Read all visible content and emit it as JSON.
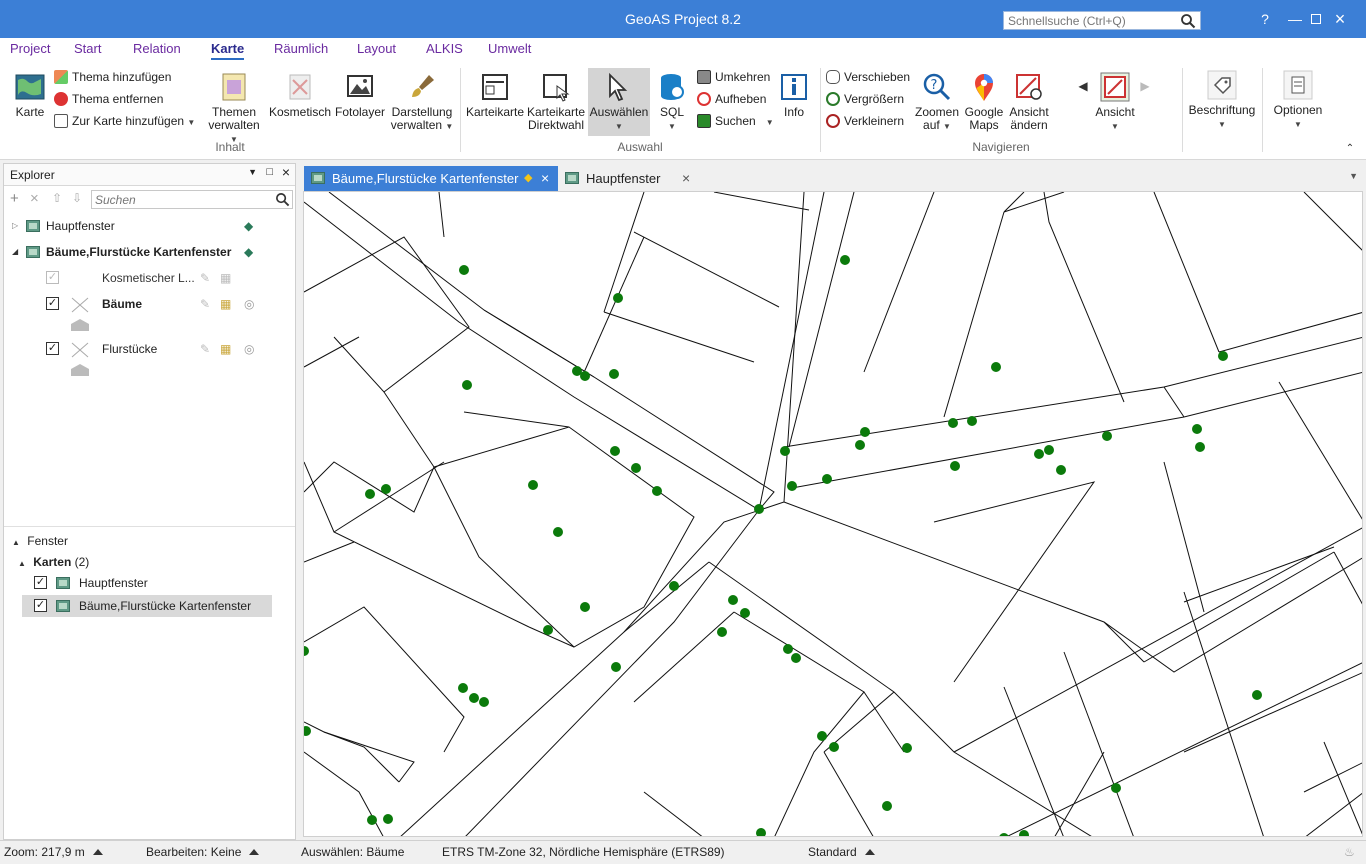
{
  "window": {
    "title": "GeoAS Project 8.2",
    "quick_search_placeholder": "Schnellsuche (Ctrl+Q)"
  },
  "ribbon_tabs": [
    "Project",
    "Start",
    "Relation",
    "Karte",
    "Räumlich",
    "Layout",
    "ALKIS",
    "Umwelt"
  ],
  "active_tab": "Karte",
  "ribbon": {
    "karte": "Karte",
    "thema_hinzufuegen": "Thema hinzufügen",
    "thema_entfernen": "Thema entfernen",
    "zur_karte_hinzufuegen": "Zur Karte hinzufügen",
    "themen_verwalten_1": "Themen",
    "themen_verwalten_2": "verwalten",
    "kosmetisch": "Kosmetisch",
    "fotolayer": "Fotolayer",
    "darstellung_1": "Darstellung",
    "darstellung_2": "verwalten",
    "group_inhalt": "Inhalt",
    "karteikarte": "Karteikarte",
    "karteikarte_direkt_1": "Karteikarte",
    "karteikarte_direkt_2": "Direktwahl",
    "auswaehlen": "Auswählen",
    "sql": "SQL",
    "umkehren": "Umkehren",
    "aufheben": "Aufheben",
    "suchen": "Suchen",
    "info": "Info",
    "group_auswahl": "Auswahl",
    "verschieben": "Verschieben",
    "vergroessern": "Vergrößern",
    "verkleinern": "Verkleinern",
    "zoomen_1": "Zoomen",
    "zoomen_2": "auf",
    "google_1": "Google",
    "google_2": "Maps",
    "ansicht_aendern_1": "Ansicht",
    "ansicht_aendern_2": "ändern",
    "ansicht": "Ansicht",
    "group_navigieren": "Navigieren",
    "beschriftung": "Beschriftung",
    "optionen": "Optionen"
  },
  "explorer": {
    "title": "Explorer",
    "search_placeholder": "Suchen",
    "items": {
      "hauptfenster": "Hauptfenster",
      "baeume_karte": "Bäume,Flurstücke Kartenfenster",
      "kosmetisch": "Kosmetischer L...",
      "baeume": "Bäume",
      "flurstuecke": "Flurstücke"
    },
    "fenster_title": "Fenster",
    "karten_label": "Karten",
    "karten_count": "(2)",
    "fenster_items": [
      "Hauptfenster",
      "Bäume,Flurstücke Kartenfenster"
    ]
  },
  "doc_tabs": [
    "Bäume,Flurstücke Kartenfenster",
    "Hauptfenster"
  ],
  "status": {
    "zoom": "Zoom: 217,9 m",
    "bearbeiten": "Bearbeiten: Keine",
    "auswaehlen": "Auswählen: Bäume",
    "crs": "ETRS TM-Zone 32, Nördliche Hemisphäre (ETRS89)",
    "standard": "Standard"
  },
  "colors": {
    "accent": "#3c7fd6",
    "tree": "#0b7a0b"
  }
}
